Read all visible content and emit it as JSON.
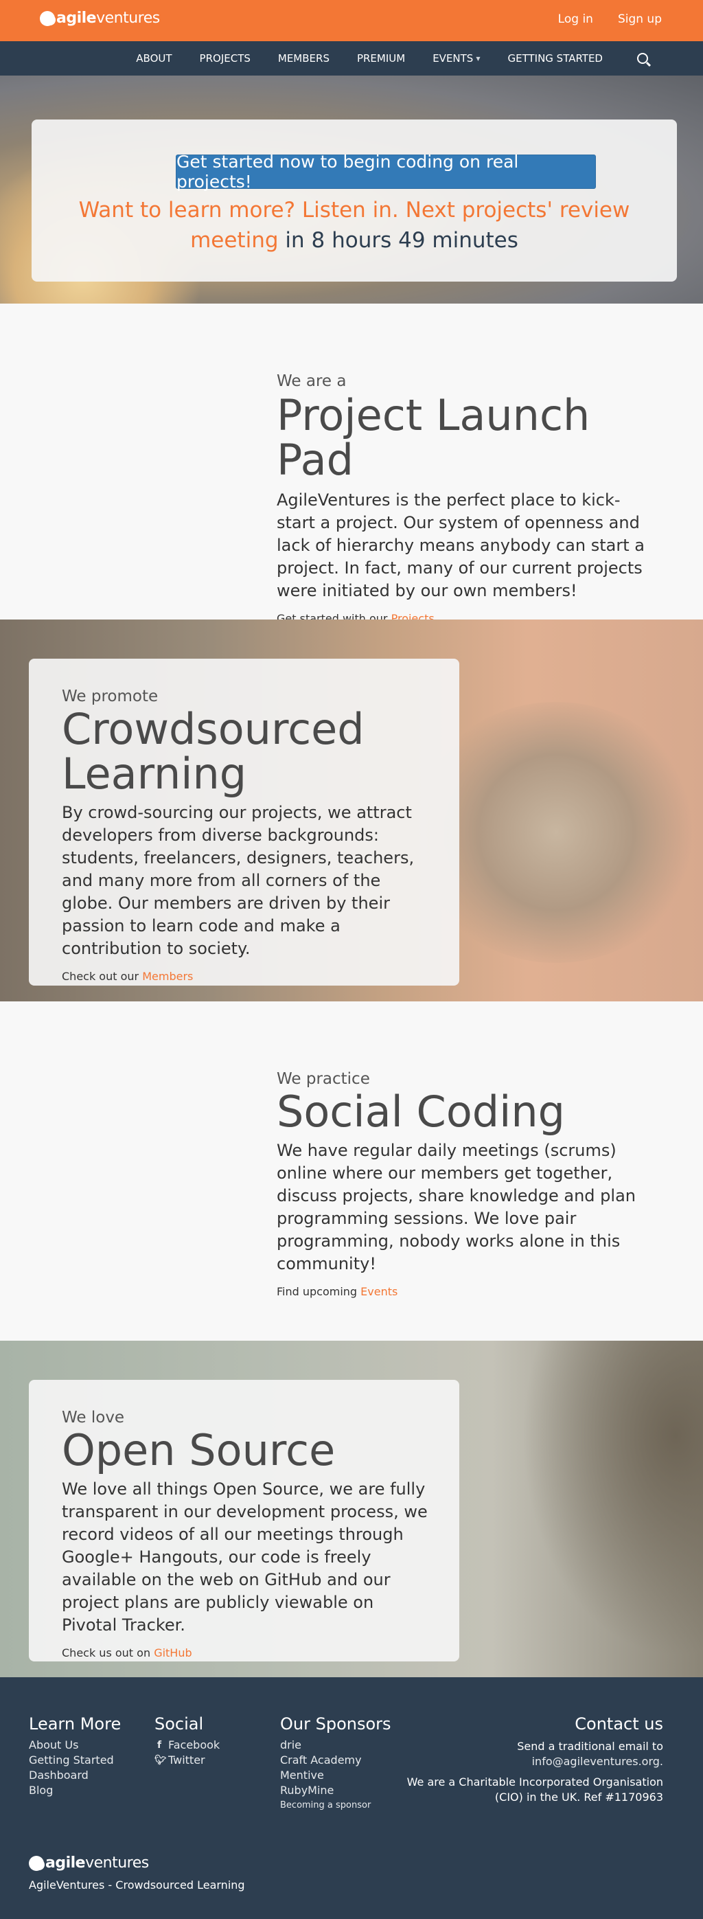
{
  "brand": {
    "logo_strong": "agile",
    "logo_light": "ventures",
    "accent": "#f37735",
    "navy": "#2d3e50",
    "button_blue": "#337ab7"
  },
  "topbar": {
    "login": "Log in",
    "signup": "Sign up"
  },
  "nav": {
    "items": [
      {
        "label": "ABOUT"
      },
      {
        "label": "PROJECTS"
      },
      {
        "label": "MEMBERS"
      },
      {
        "label": "PREMIUM"
      },
      {
        "label": "EVENTS"
      },
      {
        "label": "GETTING STARTED"
      }
    ],
    "search_icon": "search-icon"
  },
  "hero": {
    "cta": "Get started now to begin coding on real projects!",
    "line1": "Want to learn more? Listen in. Next projects' review",
    "line2_orange": "meeting",
    "line2_dark": "in 8 hours 49 minutes"
  },
  "sections": {
    "launch": {
      "eyebrow": "We are a",
      "title": "Project Launch Pad",
      "body": "AgileVentures is the perfect place to kick-start a project. Our system of openness and lack of hierarchy means anybody can start a project. In fact, many of our current projects were initiated by our own members!",
      "cta_prefix": "Get started with our",
      "cta_link": "Projects"
    },
    "crowd": {
      "eyebrow": "We promote",
      "title_line1": "Crowdsourced",
      "title_line2": "Learning",
      "body": "By crowd-sourcing our projects, we attract developers from diverse backgrounds: students, freelancers, designers, teachers, and many more from all corners of the globe. Our members are driven by their passion to learn code and make a contribution to society.",
      "cta_prefix": "Check out our",
      "cta_link": "Members"
    },
    "social": {
      "eyebrow": "We practice",
      "title": "Social Coding",
      "body": "We have regular daily meetings (scrums) online where our members get together, discuss projects, share knowledge and plan programming sessions. We love pair programming, nobody works alone in this community!",
      "cta_prefix": "Find upcoming",
      "cta_link": "Events"
    },
    "open": {
      "eyebrow": "We love",
      "title": "Open Source",
      "body": "We love all things Open Source, we are fully transparent in our development process, we record videos of all our meetings through Google+ Hangouts, our code is freely available on the web on GitHub and our project plans are publicly viewable on Pivotal Tracker.",
      "cta_prefix": "Check us out on",
      "cta_link": "GitHub"
    }
  },
  "footer": {
    "learn": {
      "title": "Learn More",
      "links": [
        "About Us",
        "Getting Started",
        "Dashboard",
        "Blog"
      ]
    },
    "social": {
      "title": "Social",
      "links": [
        {
          "label": "Facebook",
          "icon": "facebook-icon"
        },
        {
          "label": "Twitter",
          "icon": "twitter-icon"
        }
      ]
    },
    "sponsors": {
      "title": "Our Sponsors",
      "links": [
        "drie",
        "Craft Academy",
        "Mentive",
        "RubyMine"
      ],
      "small_link": "Becoming a sponsor"
    },
    "contact": {
      "title": "Contact us",
      "line1": "Send a traditional email to",
      "email": "info@agileventures.org.",
      "line3": "We are a Charitable Incorporated Organisation",
      "line4": "(CIO) in the UK. Ref #1170963"
    },
    "tagline": "AgileVentures - Crowdsourced Learning"
  }
}
